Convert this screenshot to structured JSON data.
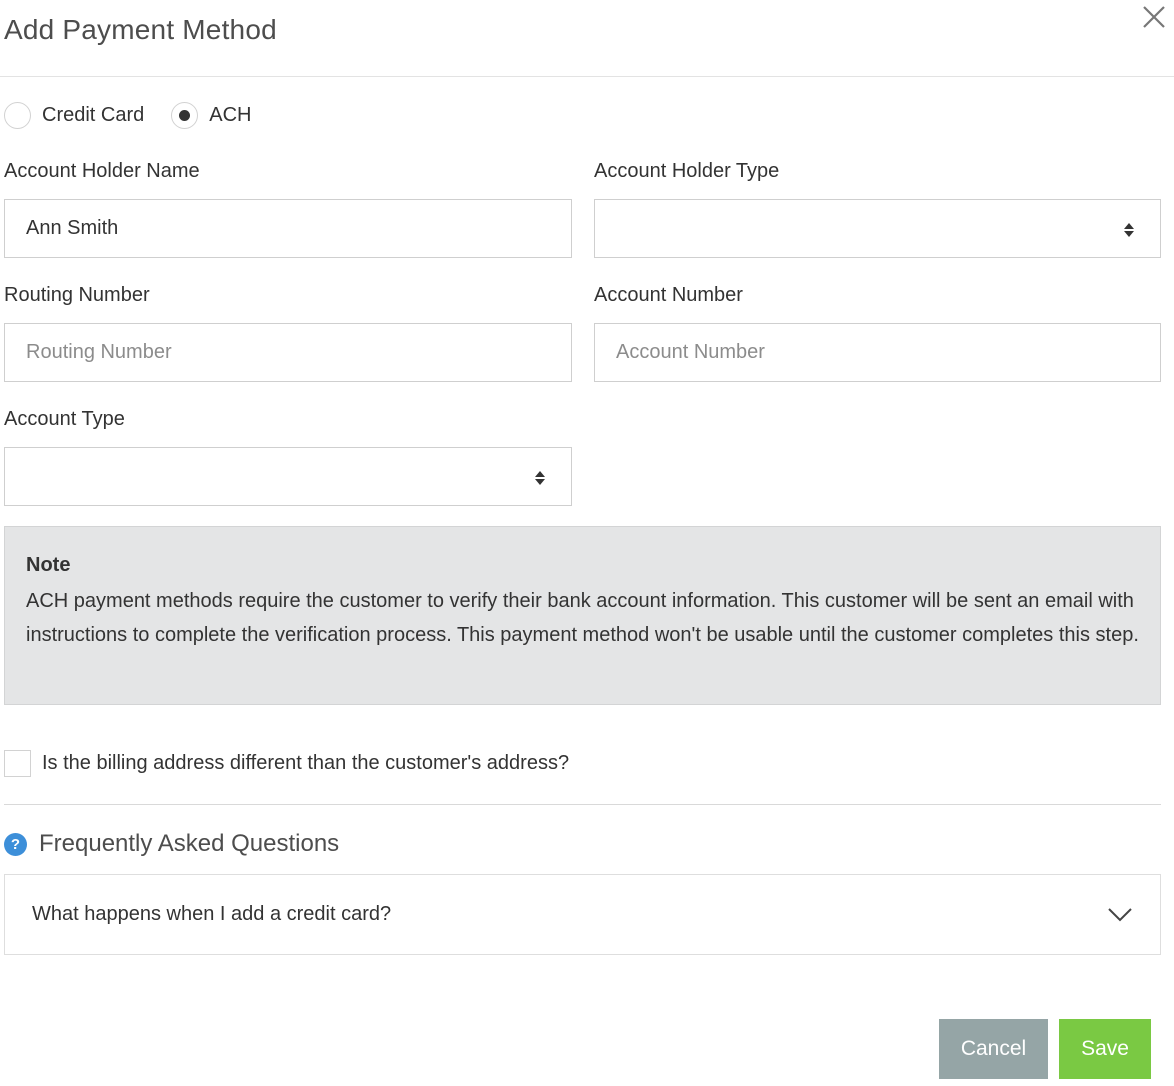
{
  "modal": {
    "title": "Add Payment Method"
  },
  "payment_type": {
    "options": [
      {
        "label": "Credit Card",
        "checked": false
      },
      {
        "label": "ACH",
        "checked": true
      }
    ]
  },
  "fields": {
    "account_holder_name": {
      "label": "Account Holder Name",
      "value": "Ann Smith",
      "placeholder": ""
    },
    "account_holder_type": {
      "label": "Account Holder Type",
      "selected": ""
    },
    "routing_number": {
      "label": "Routing Number",
      "value": "",
      "placeholder": "Routing Number"
    },
    "account_number": {
      "label": "Account Number",
      "value": "",
      "placeholder": "Account Number"
    },
    "account_type": {
      "label": "Account Type",
      "selected": ""
    }
  },
  "note": {
    "title": "Note",
    "text": "ACH payment methods require the customer to verify their bank account information. This customer will be sent an email with instructions to complete the verification process. This payment method won't be usable until the customer completes this step."
  },
  "billing": {
    "checkbox_label": "Is the billing address different than the customer's address?",
    "checked": false
  },
  "faq": {
    "title": "Frequently Asked Questions",
    "help_icon_glyph": "?",
    "items": [
      {
        "question": "What happens when I add a credit card?"
      }
    ]
  },
  "actions": {
    "cancel_label": "Cancel",
    "save_label": "Save"
  },
  "colors": {
    "cancel_button": "#95a5a6",
    "save_button": "#7ac943",
    "help_icon": "#3d8fd9",
    "note_background": "#e4e5e6"
  },
  "icons": {
    "close": "close-icon",
    "select_arrows": "sort-arrows-icon",
    "faq_expand": "chevron-down-icon",
    "help": "question-circle-icon"
  }
}
